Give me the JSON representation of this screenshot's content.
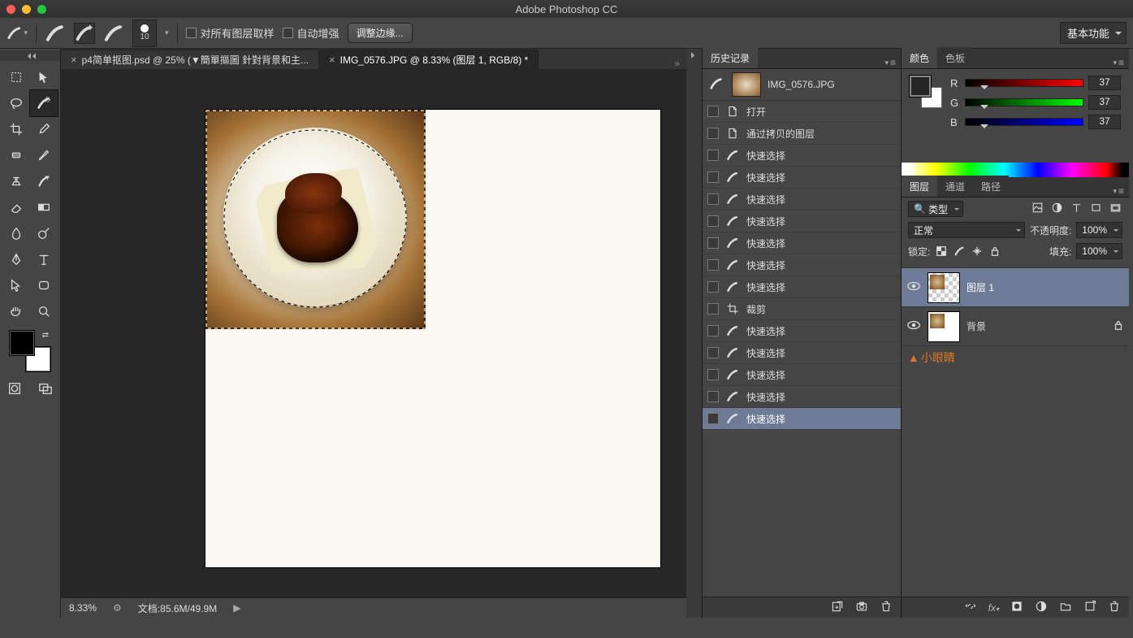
{
  "app_title": "Adobe Photoshop CC",
  "options_bar": {
    "brush_size": "10",
    "sample_all_label": "对所有图层取样",
    "auto_enhance_label": "自动增强",
    "refine_edge_label": "调整边缘...",
    "workspace_label": "基本功能"
  },
  "tabs": [
    {
      "title": "p4简单抠图.psd @ 25% (▼簡單摳圖 針對背景和主...",
      "active": false
    },
    {
      "title": "IMG_0576.JPG @ 8.33% (图层 1, RGB/8) *",
      "active": true
    }
  ],
  "status": {
    "zoom": "8.33%",
    "doc_info_label": "文档:",
    "doc_info": "85.6M/49.9M"
  },
  "history": {
    "tab_label": "历史记录",
    "doc_name": "IMG_0576.JPG",
    "items": [
      {
        "icon": "doc",
        "label": "打开"
      },
      {
        "icon": "doc",
        "label": "通过拷贝的图层"
      },
      {
        "icon": "brush",
        "label": "快速选择"
      },
      {
        "icon": "brush",
        "label": "快速选择"
      },
      {
        "icon": "brush",
        "label": "快速选择"
      },
      {
        "icon": "brush",
        "label": "快速选择"
      },
      {
        "icon": "brush",
        "label": "快速选择"
      },
      {
        "icon": "brush",
        "label": "快速选择"
      },
      {
        "icon": "brush",
        "label": "快速选择"
      },
      {
        "icon": "crop",
        "label": "裁剪"
      },
      {
        "icon": "brush",
        "label": "快速选择"
      },
      {
        "icon": "brush",
        "label": "快速选择"
      },
      {
        "icon": "brush",
        "label": "快速选择"
      },
      {
        "icon": "brush",
        "label": "快速选择"
      },
      {
        "icon": "brush",
        "label": "快速选择",
        "selected": true
      }
    ]
  },
  "color": {
    "tab_color": "颜色",
    "tab_swatch": "色板",
    "r": "37",
    "g": "37",
    "b": "37",
    "r_label": "R",
    "g_label": "G",
    "b_label": "B"
  },
  "layers": {
    "tab_layers": "图层",
    "tab_channels": "通道",
    "tab_paths": "路径",
    "filter_label": "类型",
    "blend_mode": "正常",
    "opacity_label": "不透明度:",
    "opacity": "100%",
    "lock_label": "锁定:",
    "fill_label": "填充:",
    "fill": "100%",
    "items": [
      {
        "name": "图层 1",
        "selected": true
      },
      {
        "name": "背景",
        "locked": true
      }
    ],
    "watermark": "小眼睛"
  }
}
